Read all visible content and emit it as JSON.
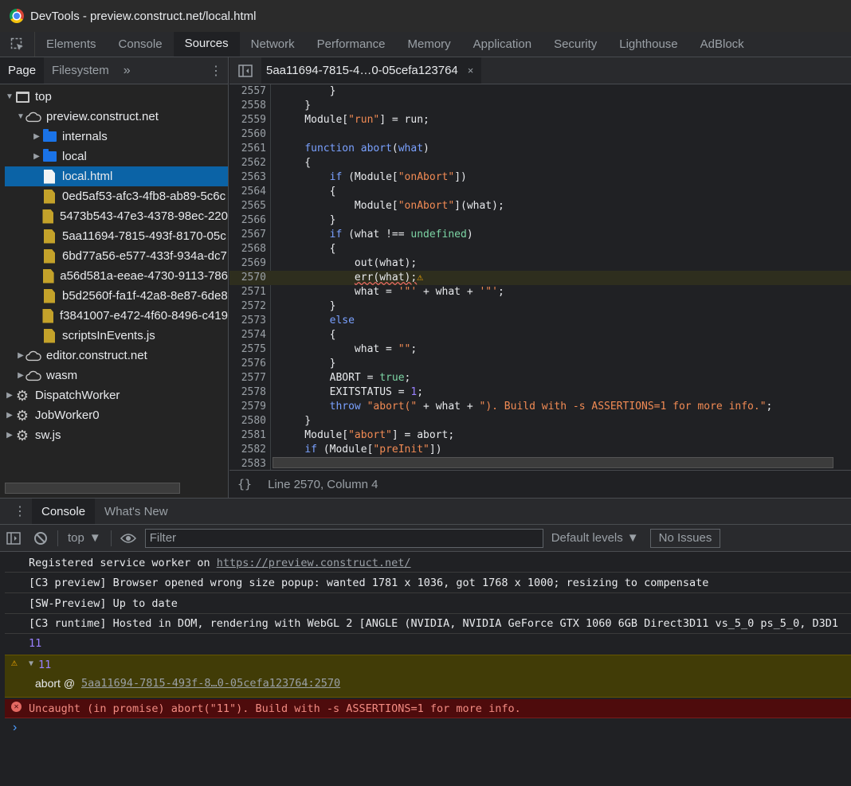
{
  "window": {
    "title": "DevTools - preview.construct.net/local.html"
  },
  "main_tabs": [
    "Elements",
    "Console",
    "Sources",
    "Network",
    "Performance",
    "Memory",
    "Application",
    "Security",
    "Lighthouse",
    "AdBlock"
  ],
  "navigator": {
    "tabs": [
      "Page",
      "Filesystem"
    ],
    "more": "»",
    "tree": [
      {
        "label": "top"
      },
      {
        "label": "preview.construct.net"
      },
      {
        "label": "internals"
      },
      {
        "label": "local"
      },
      {
        "label": "local.html"
      },
      {
        "label": "0ed5af53-afc3-4fb8-ab89-5c6c"
      },
      {
        "label": "5473b543-47e3-4378-98ec-220"
      },
      {
        "label": "5aa11694-7815-493f-8170-05c"
      },
      {
        "label": "6bd77a56-e577-433f-934a-dc7"
      },
      {
        "label": "a56d581a-eeae-4730-9113-786"
      },
      {
        "label": "b5d2560f-fa1f-42a8-8e87-6de8"
      },
      {
        "label": "f3841007-e472-4f60-8496-c419"
      },
      {
        "label": "scriptsInEvents.js"
      },
      {
        "label": "editor.construct.net"
      },
      {
        "label": "wasm"
      },
      {
        "label": "DispatchWorker"
      },
      {
        "label": "JobWorker0"
      },
      {
        "label": "sw.js"
      }
    ]
  },
  "editor": {
    "open_file": "5aa11694-7815-4…0-05cefa123764",
    "close": "×",
    "line_numbers": [
      "2557",
      "2558",
      "2559",
      "2560",
      "2561",
      "2562",
      "2563",
      "2564",
      "2565",
      "2566",
      "2567",
      "2568",
      "2569",
      "2570",
      "2571",
      "2572",
      "2573",
      "2574",
      "2575",
      "2576",
      "2577",
      "2578",
      "2579",
      "2580",
      "2581",
      "2582",
      "2583"
    ],
    "highlighted_line": "2570",
    "status": "Line 2570, Column 4",
    "braces": "{}"
  },
  "drawer": {
    "tabs": [
      "Console",
      "What's New"
    ],
    "context": "top",
    "filter_placeholder": "Filter",
    "levels": "Default levels",
    "issues": "No Issues"
  },
  "console": {
    "messages": [
      {
        "text": "Registered service worker on ",
        "link": "https://preview.construct.net/"
      },
      {
        "text": "[C3 preview] Browser opened wrong size popup: wanted 1781 x 1036, got 1768 x 1000; resizing to compensate"
      },
      {
        "text": "[SW-Preview] Up to date"
      },
      {
        "text": "[C3 runtime] Hosted in DOM, rendering with WebGL 2 [ANGLE (NVIDIA, NVIDIA GeForce GTX 1060 6GB Direct3D11 vs_5_0 ps_5_0, D3D1"
      },
      {
        "text": "11"
      }
    ],
    "warning": {
      "value": "11",
      "fn": "abort",
      "at": "@",
      "link": "5aa11694-7815-493f-8…0-05cefa123764:2570"
    },
    "error": "Uncaught (in promise) abort(\"11\"). Build with -s ASSERTIONS=1 for more info.",
    "prompt": "›"
  },
  "colors": {
    "selection": "#0b63a6",
    "warning_bg": "#413c07",
    "error_bg": "#4e0b0c",
    "string": "#f28b54",
    "keyword": "#7aa1ff"
  }
}
